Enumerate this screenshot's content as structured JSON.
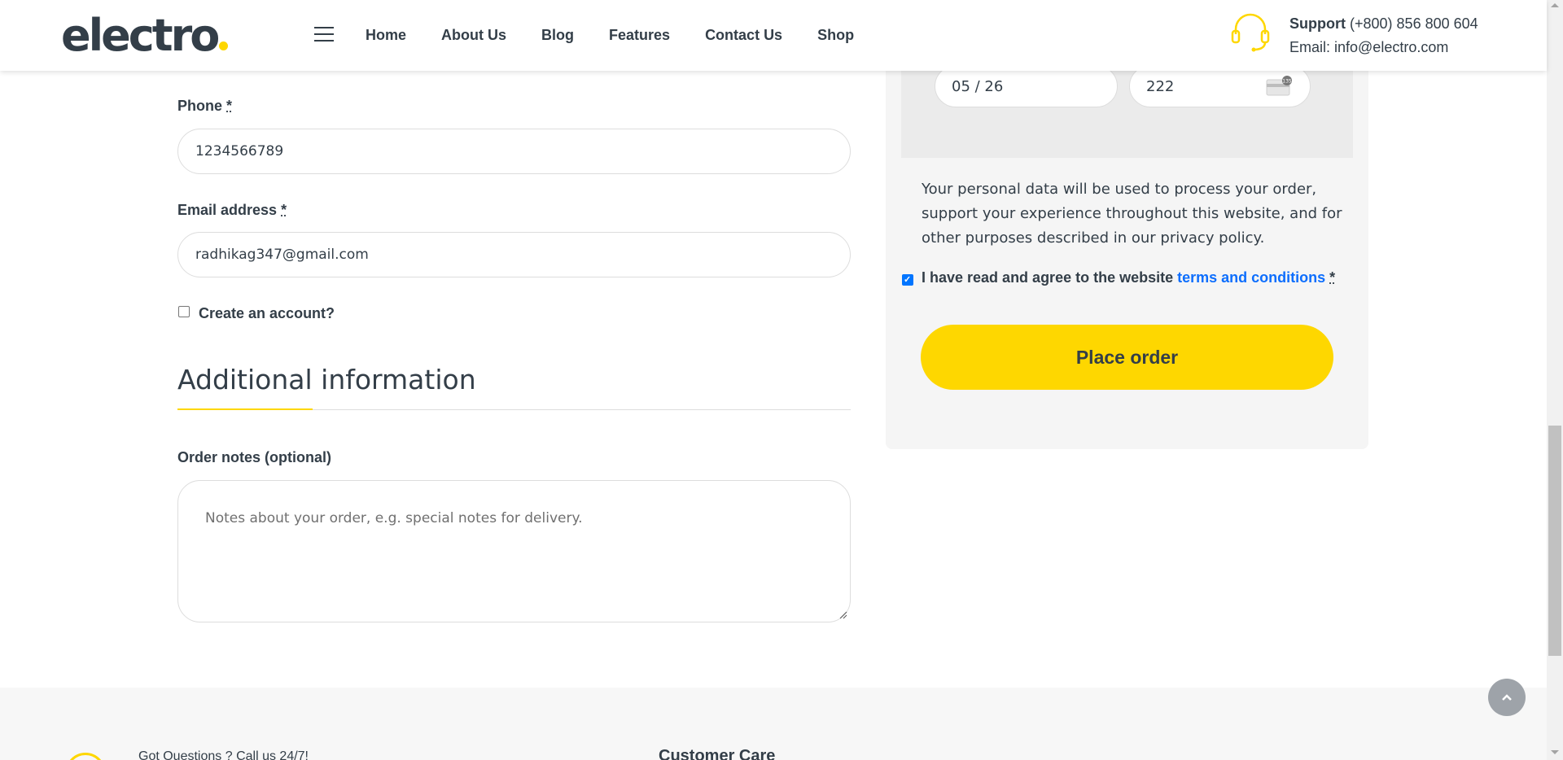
{
  "header": {
    "logo_text": "electro",
    "nav": [
      "Home",
      "About Us",
      "Blog",
      "Features",
      "Contact Us",
      "Shop"
    ],
    "support_label": "Support",
    "support_phone": "(+800) 856 800 604",
    "support_email": "Email: info@electro.com"
  },
  "billing": {
    "phone_label": "Phone",
    "phone_value": "1234566789",
    "email_label": "Email address",
    "email_value": "radhikag347@gmail.com",
    "required_mark": "*",
    "create_account_label": "Create an account?",
    "create_account_checked": false
  },
  "additional": {
    "title": "Additional information",
    "notes_label": "Order notes (optional)",
    "notes_placeholder": "Notes about your order, e.g. special notes for delivery."
  },
  "payment": {
    "expiry_value": "05 / 26",
    "cvc_value": "222",
    "privacy_text_before": "Your personal data will be used to process your order, support your experience throughout this website, and for other purposes described in our ",
    "privacy_link": "privacy policy",
    "privacy_text_after": ".",
    "terms_text": "I have read and agree to the website ",
    "terms_link": "terms and conditions",
    "terms_required": "*",
    "terms_checked": true,
    "place_order_label": "Place order"
  },
  "footer": {
    "questions_text": "Got Questions ? Call us 24/7!",
    "customer_care_title": "Customer Care"
  },
  "colors": {
    "accent": "#fed700",
    "text": "#333e48",
    "link": "#0d6efd"
  }
}
